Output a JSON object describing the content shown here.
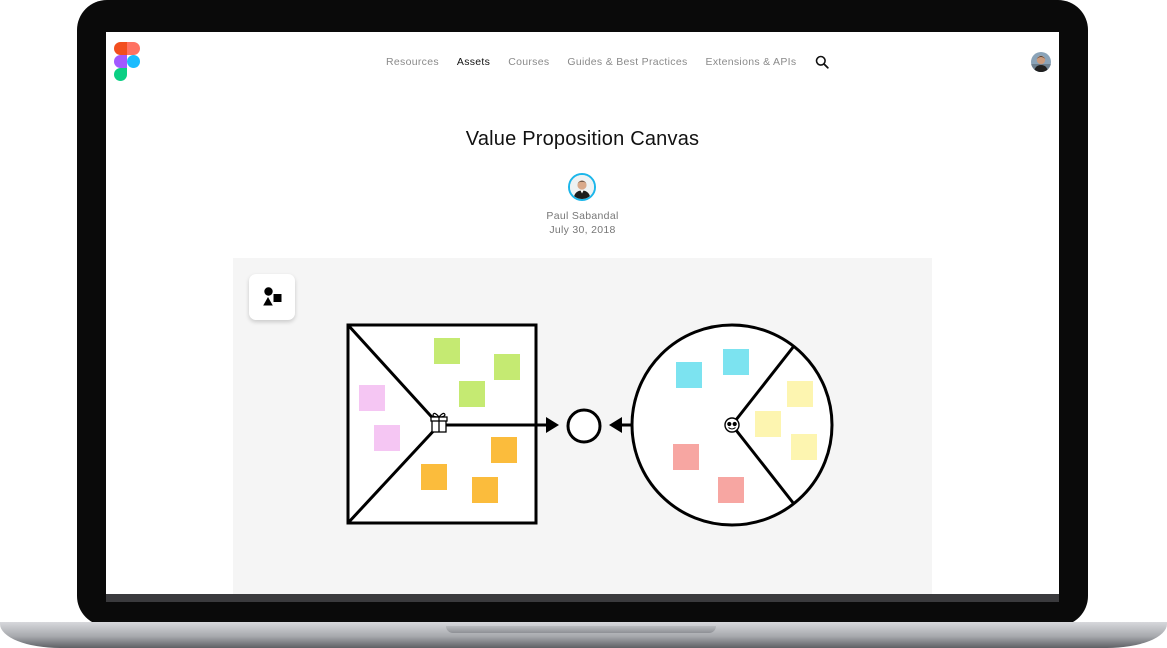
{
  "nav": {
    "items": [
      {
        "label": "Resources",
        "active": false
      },
      {
        "label": "Assets",
        "active": true
      },
      {
        "label": "Courses",
        "active": false
      },
      {
        "label": "Guides & Best Practices",
        "active": false
      },
      {
        "label": "Extensions & APIs",
        "active": false
      }
    ],
    "search_icon": "search-icon"
  },
  "header": {
    "logo": "figma-logo",
    "user_avatar": "user-avatar"
  },
  "article": {
    "title": "Value Proposition Canvas",
    "author": "Paul Sabandal",
    "date": "July 30, 2018"
  },
  "preview": {
    "badge_icon": "shapes-icon",
    "center_icons": [
      "gift-icon",
      "smiley-icon"
    ]
  },
  "colors": {
    "figma_red": "#f24e1e",
    "figma_orange": "#ff7262",
    "figma_purple": "#a259ff",
    "figma_blue": "#1abcfe",
    "figma_green": "#0acf83",
    "sticky_green": "#c5ea72",
    "sticky_pink": "#f5c6f3",
    "sticky_orange": "#fbbc3c",
    "sticky_cyan": "#7ce3f0",
    "sticky_yellow": "#fdf5b0",
    "sticky_red": "#f7a6a2",
    "avatar_ring": "#1bb6ea",
    "preview_bg": "#f5f5f5"
  }
}
